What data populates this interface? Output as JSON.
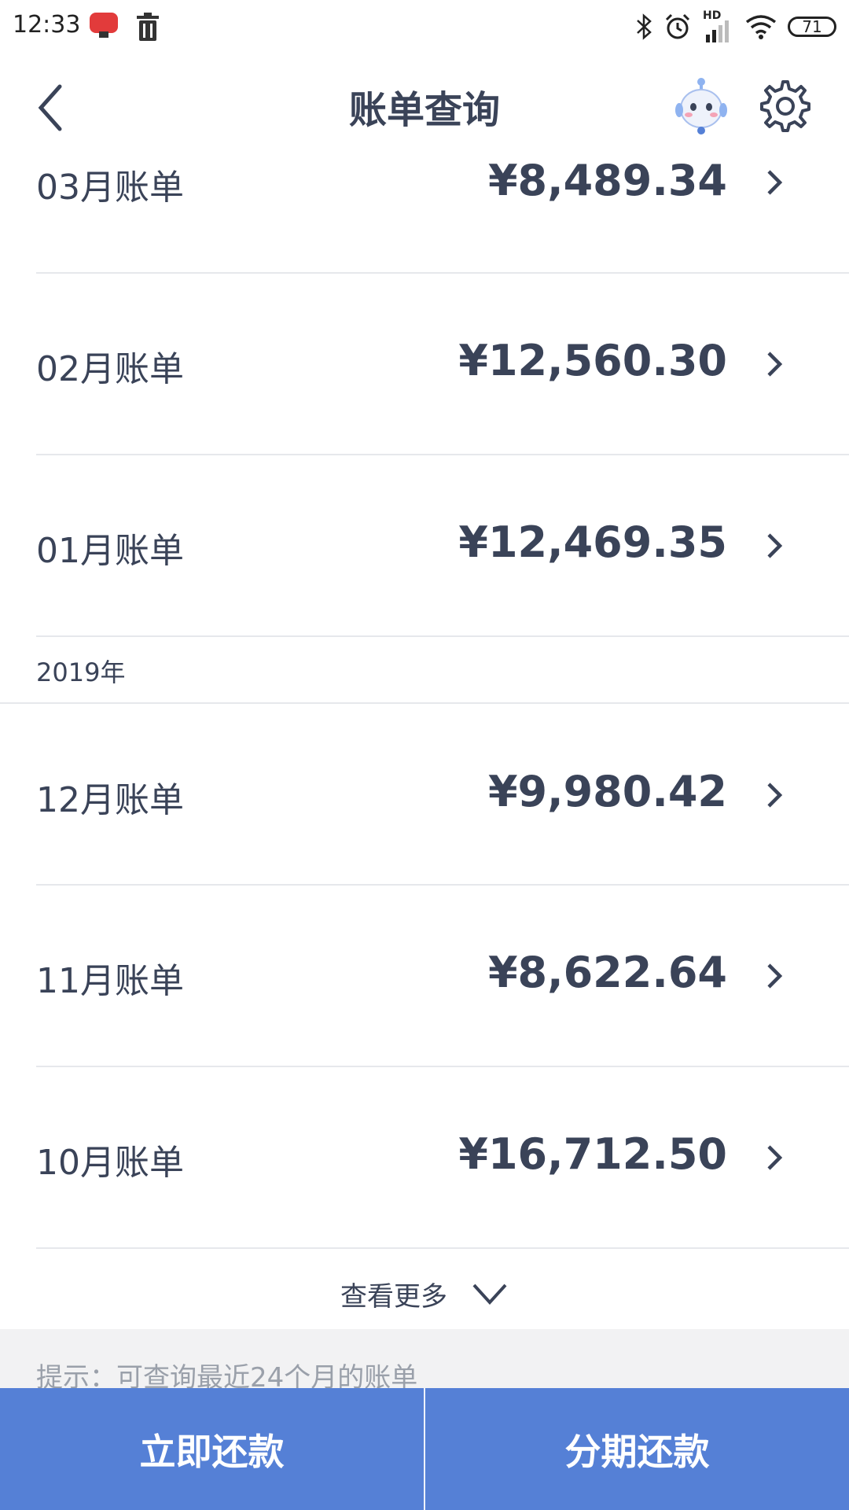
{
  "status_bar": {
    "time": "12:33",
    "battery": "71",
    "hd_label": "HD"
  },
  "header": {
    "title": "账单查询"
  },
  "bills": [
    {
      "label": "03月账单",
      "amount": "¥8,489.34"
    },
    {
      "label": "02月账单",
      "amount": "¥12,560.30"
    },
    {
      "label": "01月账单",
      "amount": "¥12,469.35"
    },
    {
      "label": "12月账单",
      "amount": "¥9,980.42"
    },
    {
      "label": "11月账单",
      "amount": "¥8,622.64"
    },
    {
      "label": "10月账单",
      "amount": "¥16,712.50"
    }
  ],
  "year_section": "2019年",
  "more_label": "查看更多",
  "tip": "提示：可查询最近24个月的账单",
  "actions": {
    "repay_now": "立即还款",
    "installment": "分期还款"
  },
  "colors": {
    "accent": "#5580d6",
    "text": "#3a4358"
  }
}
